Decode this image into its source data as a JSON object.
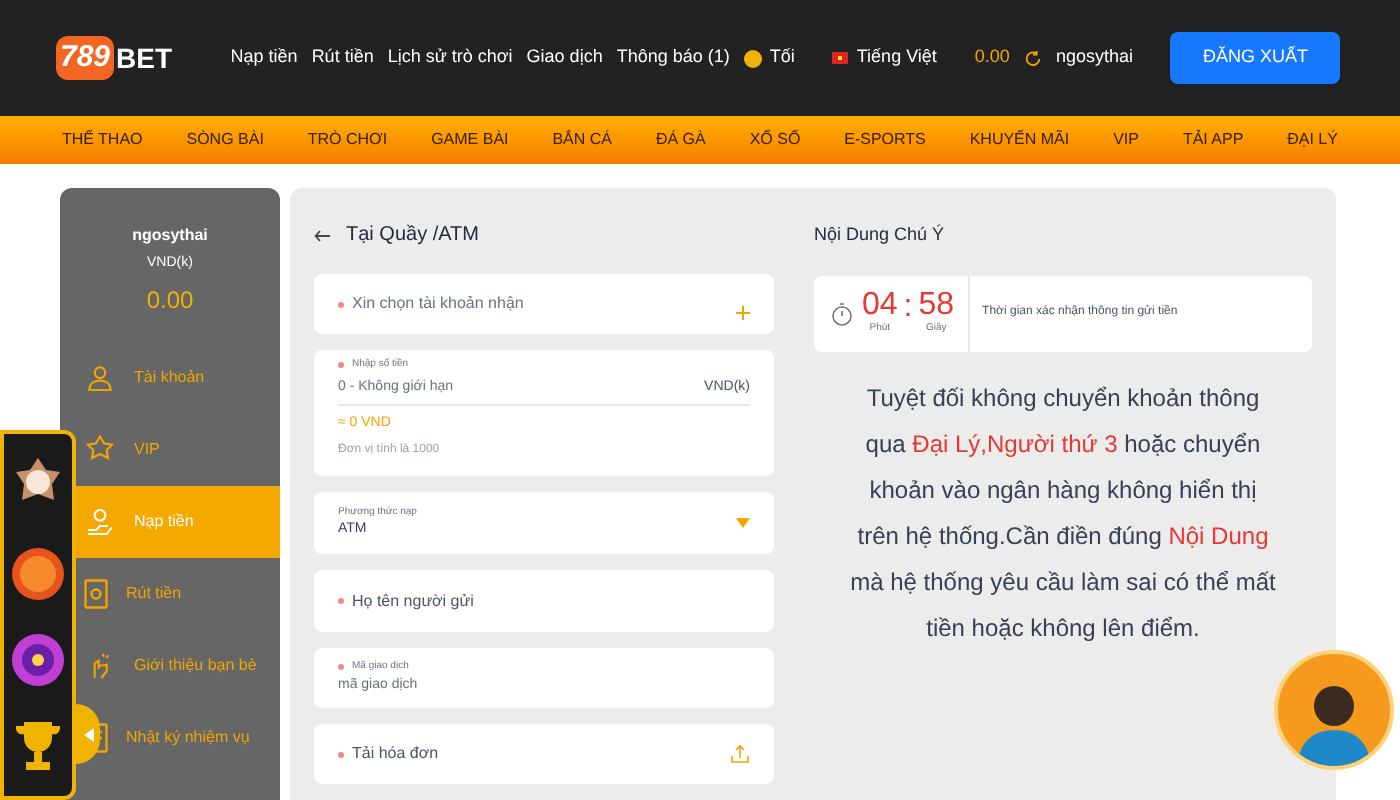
{
  "header": {
    "logo": {
      "number": "789",
      "word": "BET"
    },
    "top_links": [
      "Nạp tiền",
      "Rút tiền",
      "Lịch sử trò chơi",
      "Giao dịch",
      "Thông báo (1)"
    ],
    "theme": {
      "label": "Tối",
      "dark": true
    },
    "language": "Tiếng Việt",
    "balance": "0.00",
    "username": "ngosythai",
    "logout": "ĐĂNG XUẤT"
  },
  "categories": [
    "THỂ THAO",
    "SÒNG BÀI",
    "TRÒ CHƠI",
    "GAME BÀI",
    "BẮN CÁ",
    "ĐÁ GÀ",
    "XỔ SỐ",
    "E-SPORTS",
    "KHUYẾN MÃI",
    "VIP",
    "TẢI APP",
    "ĐẠI LÝ"
  ],
  "sidebar": {
    "username": "ngosythai",
    "currency": "VND(k)",
    "balance": "0.00",
    "items": [
      {
        "label": "Tài khoản",
        "selected": false
      },
      {
        "label": "VIP",
        "selected": false
      },
      {
        "label": "Nạp tiền",
        "selected": true
      },
      {
        "label": "Rút tiền",
        "selected": false
      },
      {
        "label": "Giới thiệu bạn bè",
        "selected": false
      },
      {
        "label": "Nhật ký nhiệm vụ",
        "selected": false
      }
    ]
  },
  "form": {
    "title": "Tại Quầy /ATM",
    "fields": [
      {
        "kind": "account",
        "label": "Xin chọn tài khoản nhận",
        "required": true
      },
      {
        "kind": "amount",
        "label": "Nhập số tiền",
        "required": true,
        "placeholder": "0 - Không giới hạn",
        "unit": "VND(k)",
        "converted": "≈ 0 VND",
        "note": "Đơn vị tính là 1000"
      },
      {
        "kind": "dropdown",
        "label": "Phương thức nạp",
        "required": false,
        "value": "ATM"
      },
      {
        "kind": "text",
        "label": "Họ tên người gửi",
        "required": true
      },
      {
        "kind": "input",
        "label": "Mã giao dịch",
        "required": true,
        "placeholder": "mã giao dịch"
      },
      {
        "kind": "upload",
        "label": "Tải hóa đơn",
        "required": true
      }
    ]
  },
  "notice": {
    "title": "Nội Dung Chú Ý",
    "timer": {
      "minutes": "04",
      "separator": ":",
      "seconds": "58",
      "minutes_label": "Phút",
      "seconds_label": "Giây",
      "caption": "Thời gian xác nhận thông tin gửi tiền"
    },
    "warning": [
      {
        "text": "Tuyệt đối không chuyển khoản thông qua ",
        "highlight": false
      },
      {
        "text": "Đại Lý,Người thứ 3",
        "highlight": true
      },
      {
        "text": " hoặc chuyển khoản vào ngân hàng không hiển thị trên hệ thống.Cần điền đúng ",
        "highlight": false
      },
      {
        "text": "Nội Dung",
        "highlight": true
      },
      {
        "text": " mà hệ thống yêu cầu làm sai có thể mất tiền hoặc không lên điểm.",
        "highlight": false
      }
    ]
  }
}
